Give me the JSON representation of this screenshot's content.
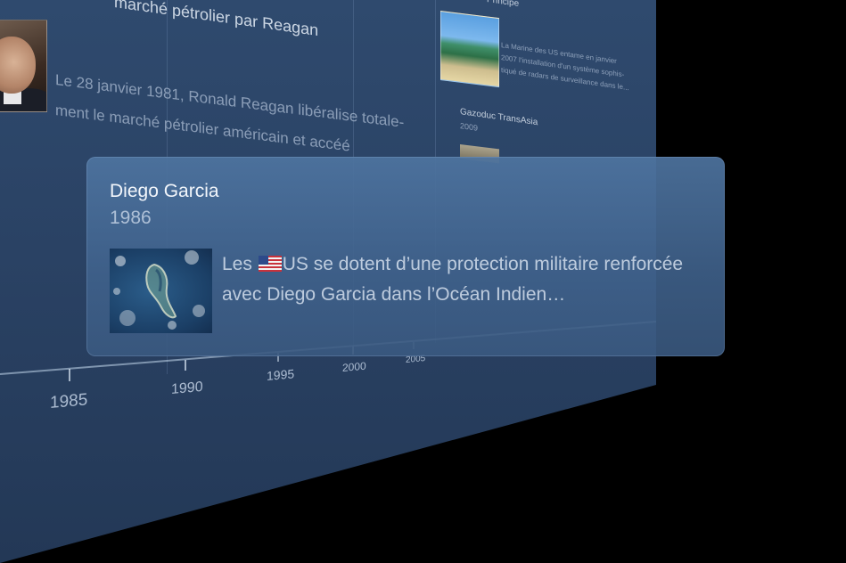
{
  "background": {
    "heading_partial": "marché pétrolier par Reagan",
    "body_line1": "Le 28 janvier 1981, Ronald Reagan libéralise totale-",
    "body_line2": "ment le marché pétrolier américain et accéé",
    "right_heading": "Principe",
    "right_text1": "La Marine des US entame en janvier",
    "right_text2": "2007 l'installation d'un système sophis-",
    "right_text3": "tiqué de radars de surveillance dans le...",
    "right_heading2": "Gazoduc TransAsia",
    "right_year2": "2009"
  },
  "timeline": {
    "ticks": [
      "1985",
      "1990",
      "1995",
      "2000",
      "2005"
    ]
  },
  "card": {
    "title": "Diego Garcia",
    "year": "1986",
    "text_before_flag": "Les ",
    "text_after_flag": "US se dotent d’une protection militaire renforcée avec Diego Garcia dans l’Océan Indien…",
    "image_icon": "island-satellite-image",
    "flag_icon": "us-flag-icon"
  },
  "colors": {
    "panel": "#2a4264",
    "card": "#4a6f9c",
    "background": "#000000"
  }
}
